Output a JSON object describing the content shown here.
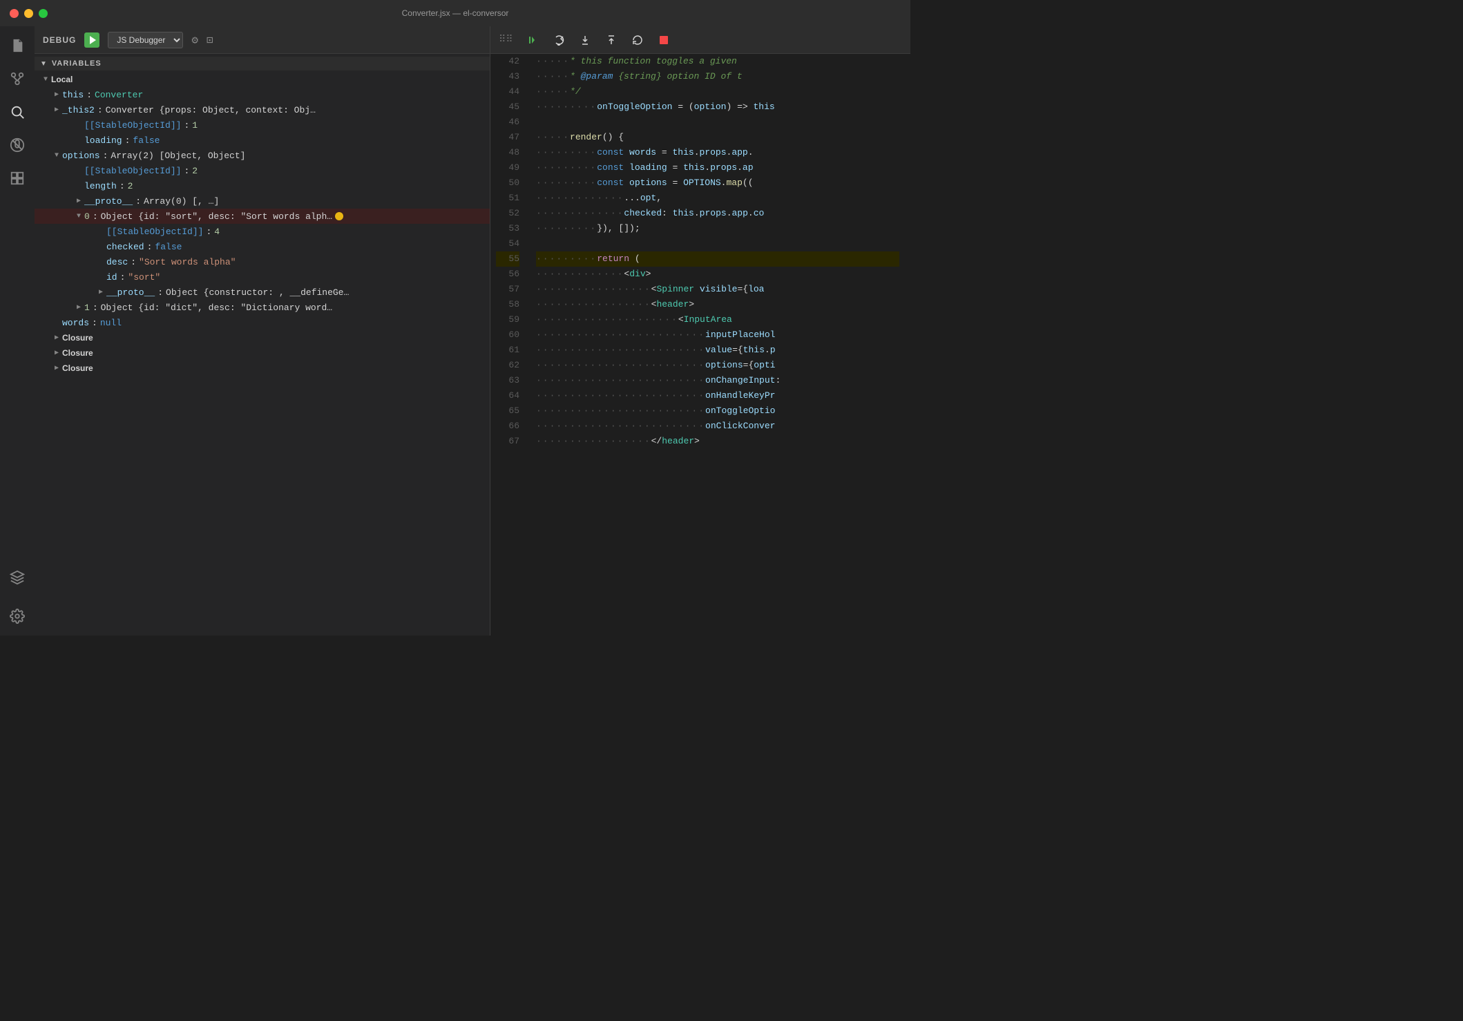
{
  "titlebar": {
    "title": "Converter.jsx — el-conversor"
  },
  "debug_panel": {
    "label": "DEBUG",
    "debugger_select": "JS Debugger",
    "sections": {
      "variables": "VARIABLES",
      "local": "Local"
    },
    "variables": [
      {
        "depth": 0,
        "type": "expandable",
        "expanded": true,
        "name": "this",
        "colon": ":",
        "value": "Converter",
        "value_type": "class-name"
      },
      {
        "depth": 0,
        "type": "expandable",
        "expanded": false,
        "name": "_this2",
        "colon": ":",
        "value": "Converter {props: Object, context: Obj…",
        "value_type": "object-desc"
      },
      {
        "depth": 1,
        "type": "leaf",
        "name": "[[StableObjectId]]",
        "colon": ":",
        "value": "1",
        "value_type": "number",
        "name_type": "special"
      },
      {
        "depth": 1,
        "type": "leaf",
        "name": "loading",
        "colon": ":",
        "value": "false",
        "value_type": "boolean"
      },
      {
        "depth": 0,
        "type": "expandable",
        "expanded": true,
        "name": "options",
        "colon": ":",
        "value": "Array(2) [Object, Object]",
        "value_type": "array-desc"
      },
      {
        "depth": 1,
        "type": "leaf",
        "name": "[[StableObjectId]]",
        "colon": ":",
        "value": "2",
        "value_type": "number",
        "name_type": "special"
      },
      {
        "depth": 1,
        "type": "leaf",
        "name": "length",
        "colon": ":",
        "value": "2",
        "value_type": "number"
      },
      {
        "depth": 1,
        "type": "expandable",
        "expanded": false,
        "name": "__proto__",
        "colon": ":",
        "value": "Array(0) [, …]",
        "value_type": "array-desc"
      },
      {
        "depth": 1,
        "type": "expandable",
        "expanded": true,
        "name": "0",
        "colon": ":",
        "value": "Object {id: \"sort\", desc: \"Sort words alph…",
        "value_type": "object-desc",
        "name_type": "index",
        "has_breakpoint": true
      },
      {
        "depth": 2,
        "type": "leaf",
        "name": "[[StableObjectId]]",
        "colon": ":",
        "value": "4",
        "value_type": "number",
        "name_type": "special"
      },
      {
        "depth": 2,
        "type": "leaf",
        "name": "checked",
        "colon": ":",
        "value": "false",
        "value_type": "boolean"
      },
      {
        "depth": 2,
        "type": "leaf",
        "name": "desc",
        "colon": ":",
        "value": "\"Sort words alpha\"",
        "value_type": "string"
      },
      {
        "depth": 2,
        "type": "leaf",
        "name": "id",
        "colon": ":",
        "value": "\"sort\"",
        "value_type": "string"
      },
      {
        "depth": 2,
        "type": "expandable",
        "expanded": false,
        "name": "__proto__",
        "colon": ":",
        "value": "Object {constructor: , __defineGe…",
        "value_type": "object-desc"
      },
      {
        "depth": 1,
        "type": "expandable",
        "expanded": false,
        "name": "1",
        "colon": ":",
        "value": "Object {id: \"dict\", desc: \"Dictionary word…",
        "value_type": "object-desc",
        "name_type": "index"
      },
      {
        "depth": 0,
        "type": "leaf",
        "name": "words",
        "colon": ":",
        "value": "null",
        "value_type": "null-val"
      }
    ],
    "closures": [
      {
        "label": "Closure"
      },
      {
        "label": "Closure"
      },
      {
        "label": "Closure"
      }
    ]
  },
  "debug_controls": {
    "buttons": [
      "continue",
      "step-over",
      "step-into",
      "step-out",
      "restart",
      "stop"
    ]
  },
  "code": {
    "lines": [
      {
        "num": 42,
        "content": "comment_start"
      },
      {
        "num": 43,
        "content": "param_line"
      },
      {
        "num": 44,
        "content": "comment_end"
      },
      {
        "num": 45,
        "content": "toggle_option"
      },
      {
        "num": 46,
        "content": "empty"
      },
      {
        "num": 47,
        "content": "render"
      },
      {
        "num": 48,
        "content": "const_words"
      },
      {
        "num": 49,
        "content": "const_loading"
      },
      {
        "num": 50,
        "content": "const_options"
      },
      {
        "num": 51,
        "content": "spread_opt"
      },
      {
        "num": 52,
        "content": "checked"
      },
      {
        "num": 53,
        "content": "close_map"
      },
      {
        "num": 54,
        "content": "empty"
      },
      {
        "num": 55,
        "content": "return",
        "is_return": true
      },
      {
        "num": 56,
        "content": "div_open"
      },
      {
        "num": 57,
        "content": "spinner"
      },
      {
        "num": 58,
        "content": "header_open"
      },
      {
        "num": 59,
        "content": "input_area"
      },
      {
        "num": 60,
        "content": "input_placeholder"
      },
      {
        "num": 61,
        "content": "value_prop"
      },
      {
        "num": 62,
        "content": "options_prop"
      },
      {
        "num": 63,
        "content": "on_change"
      },
      {
        "num": 64,
        "content": "on_handle"
      },
      {
        "num": 65,
        "content": "on_toggle"
      },
      {
        "num": 66,
        "content": "on_click"
      },
      {
        "num": 67,
        "content": "header_close"
      }
    ]
  },
  "activity": {
    "icons": [
      "files",
      "source-control",
      "search",
      "no-microphone",
      "explorer",
      "extensions",
      "settings"
    ]
  }
}
